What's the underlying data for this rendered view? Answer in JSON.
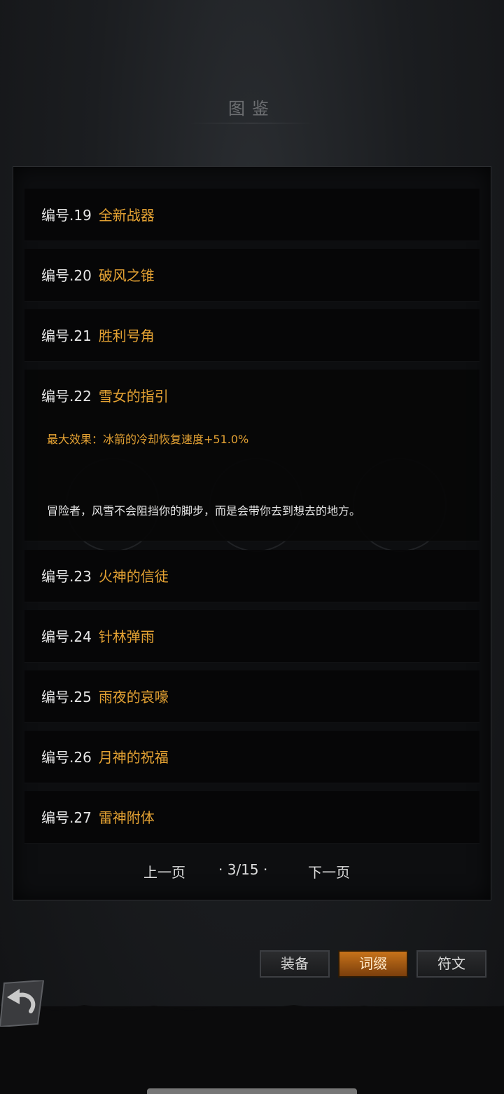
{
  "page_title": "图鉴",
  "entries": [
    {
      "num": "编号.19",
      "name": "全新战器"
    },
    {
      "num": "编号.20",
      "name": "破风之锥"
    },
    {
      "num": "编号.21",
      "name": "胜利号角"
    },
    {
      "num": "编号.22",
      "name": "雪女的指引",
      "effect": "最大效果：冰箭的冷却恢复速度+51.0%",
      "lore": "冒险者，风雪不会阻挡你的脚步，而是会带你去到想去的地方。"
    },
    {
      "num": "编号.23",
      "name": "火神的信徒"
    },
    {
      "num": "编号.24",
      "name": "针林弹雨"
    },
    {
      "num": "编号.25",
      "name": "雨夜的哀嚎"
    },
    {
      "num": "编号.26",
      "name": "月神的祝福"
    },
    {
      "num": "编号.27",
      "name": "雷神附体"
    }
  ],
  "pager": {
    "prev": "上一页",
    "page": "· 3/15 ·",
    "next": "下一页"
  },
  "tabs": [
    {
      "label": "装备",
      "active": false
    },
    {
      "label": "词缀",
      "active": true
    },
    {
      "label": "符文",
      "active": false
    }
  ],
  "colors": {
    "accent": "#e4a233",
    "active_tab": "#c7731a"
  },
  "icons": {
    "back": "back-arrow-icon"
  }
}
